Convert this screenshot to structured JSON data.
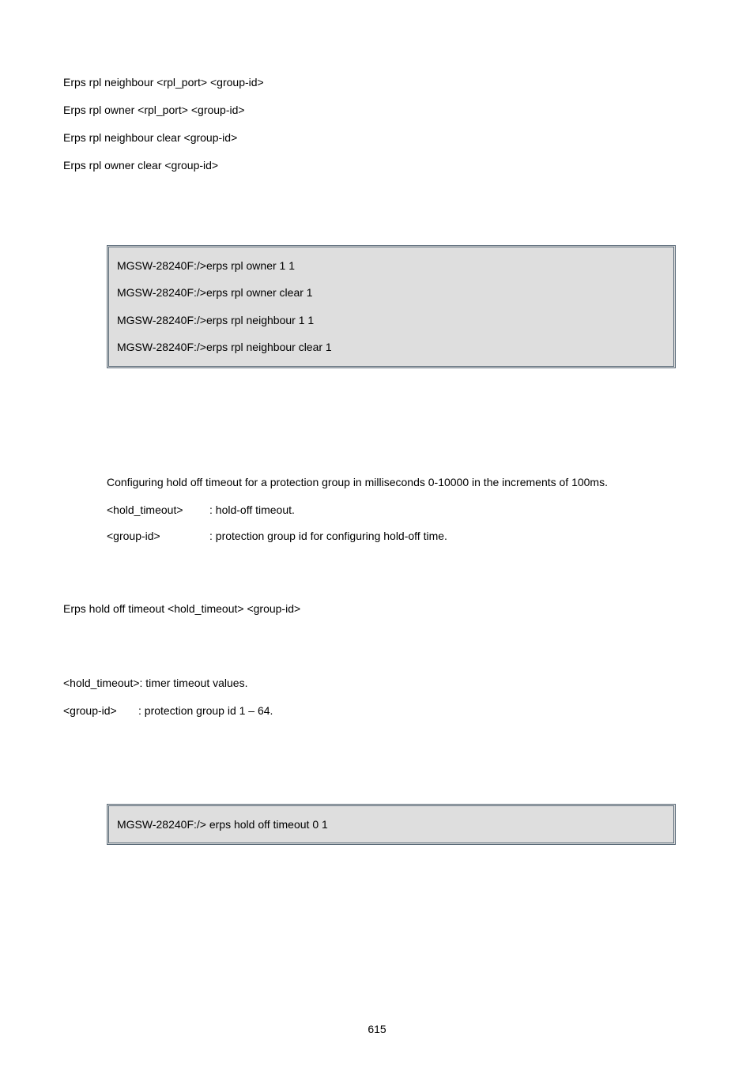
{
  "syntax": {
    "line1": "Erps rpl neighbour <rpl_port> <group-id>",
    "line2": "Erps rpl owner <rpl_port> <group-id>",
    "line3": "Erps rpl neighbour clear <group-id>",
    "line4": "Erps rpl owner clear <group-id>"
  },
  "example1": {
    "l1": "MGSW-28240F:/>erps rpl owner 1 1",
    "l2": "MGSW-28240F:/>erps rpl owner clear 1",
    "l3": "MGSW-28240F:/>erps rpl neighbour 1 1",
    "l4": "MGSW-28240F:/>erps rpl neighbour clear 1"
  },
  "desc2": {
    "intro": "Configuring hold off timeout for a protection group in milliseconds 0-10000 in the increments of 100ms.",
    "p1_key": "<hold_timeout>",
    "p1_val": ": hold-off timeout.",
    "p2_key": "<group-id>",
    "p2_val": ": protection group id for configuring hold-off time."
  },
  "syntax2": "Erps hold off timeout <hold_timeout> <group-id>",
  "params2": {
    "p1": "<hold_timeout>: timer timeout values.",
    "p2_key": "<group-id>",
    "p2_val": ": protection group id 1 – 64."
  },
  "example2": {
    "l1": "MGSW-28240F:/> erps hold off timeout 0 1"
  },
  "pageNumber": "615"
}
